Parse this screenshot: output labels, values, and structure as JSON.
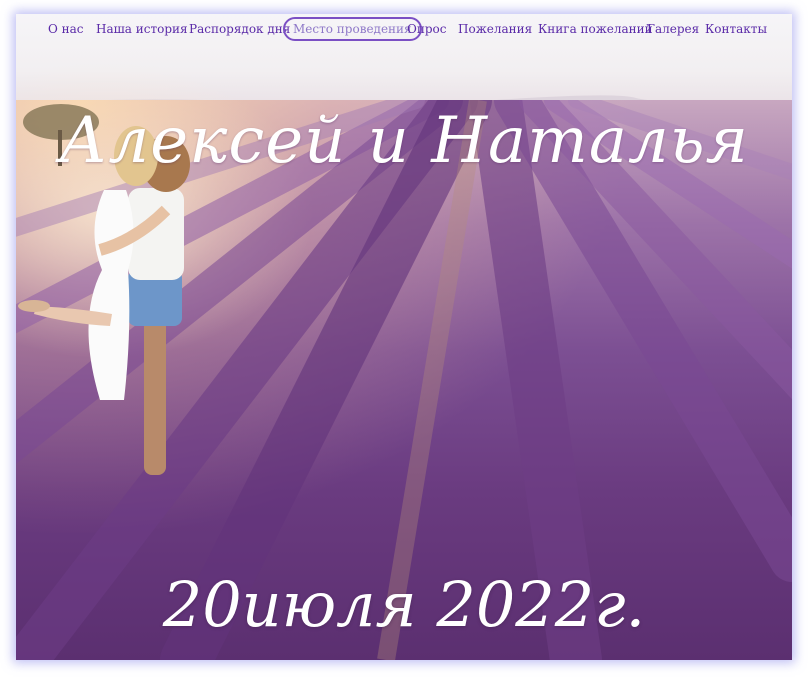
{
  "nav": {
    "items": [
      {
        "label": "О нас"
      },
      {
        "label": "Наша история"
      },
      {
        "label": "Распорядок дня"
      },
      {
        "label": "Место проведения"
      },
      {
        "label": "Опрос"
      },
      {
        "label": "Пожелания"
      },
      {
        "label": "Книга пожеланий"
      },
      {
        "label": "Галерея"
      },
      {
        "label": "Контакты"
      }
    ],
    "active_index": 3
  },
  "hero": {
    "names": "Алексей и Наталья",
    "date": "20июля 2022г."
  },
  "colors": {
    "nav_text": "#5a2aa8",
    "active_border": "#7b4fc4",
    "active_text": "#8e78c8",
    "lavender": "#7c4f93",
    "frame_glow": "#8c8ceb"
  }
}
